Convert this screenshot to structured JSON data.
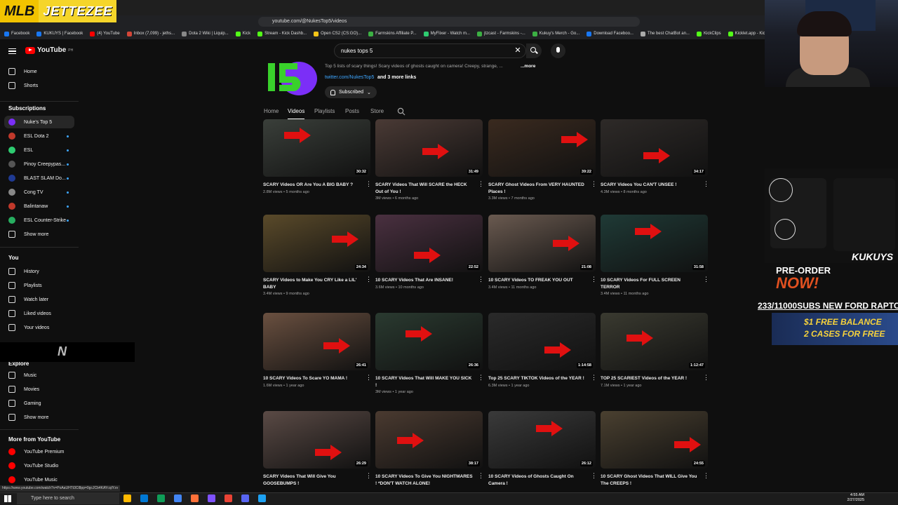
{
  "stream_overlay": {
    "logo_left": "MLB",
    "logo_right": "JETTEZEE",
    "bar_mark": "N",
    "subs_ticker": "233/11000SUBS NEW FORD RAPTOR",
    "preorder": "PRE-ORDER",
    "now": "NOW!",
    "brand": "KUKUYS",
    "promo_line1": "$1 FREE BALANCE",
    "promo_line2": "2 CASES FOR FREE"
  },
  "browser": {
    "url": "youtube.com/@NukesTop5/videos",
    "status_url": "https://www.youtube.com/watch?v=PoAaUHTt3Cl8pp=0gcJCb4KAYcqIYzv",
    "bookmarks": [
      "Facebook",
      "KUKUYS | Facebook",
      "(4) YouTube",
      "Inbox (7,099) - jeths...",
      "Dota 2 Wiki | Liquip...",
      "Kick",
      "Stream - Kick Dashb...",
      "Open CS2 (CS:GO)...",
      "Farmskins Affiliate P...",
      "MyFlixer - Watch m...",
      "jtzcast - Farmskins -...",
      "Kukuy's Merch - Go...",
      "Download Faceboo...",
      "The best ChatBot an...",
      "KickClips",
      "Kicklet.app - Kick..."
    ]
  },
  "header": {
    "logo": "YouTube",
    "region": "PH",
    "search_value": "nukes tops 5",
    "clear_icon": "✕"
  },
  "sidebar": {
    "home": "Home",
    "shorts": "Shorts",
    "subscriptions_heading": "Subscriptions",
    "subscriptions": [
      {
        "label": "Nuke's Top 5",
        "color": "#7b2ff7"
      },
      {
        "label": "ESL Dota 2",
        "color": "#c0392b"
      },
      {
        "label": "ESL",
        "color": "#2ecc71"
      },
      {
        "label": "Pinoy Creepypas...",
        "color": "#555555"
      },
      {
        "label": "BLAST SLAM Do...",
        "color": "#1f3a93"
      },
      {
        "label": "Cong TV",
        "color": "#888888"
      },
      {
        "label": "Balintanaw",
        "color": "#c0392b"
      },
      {
        "label": "ESL Counter-Strike",
        "color": "#27ae60"
      }
    ],
    "show_more": "Show more",
    "you_heading": "You",
    "you_items": [
      "History",
      "Playlists",
      "Watch later",
      "Liked videos",
      "Your videos"
    ],
    "explore_heading": "Explore",
    "explore_items": [
      "Music",
      "Movies",
      "Gaming"
    ],
    "show_more_2": "Show more",
    "more_heading": "More from YouTube",
    "more_items": [
      "YouTube Premium",
      "YouTube Studio",
      "YouTube Music"
    ]
  },
  "channel": {
    "description": "Top 5 lists of scary things! Scary videos of ghosts caught on camera! Creepy, strange, ...",
    "more": "...more",
    "link": "twitter.com/NukesTop5",
    "link_extra": "and 3 more links",
    "subscribed": "Subscribed",
    "tabs": [
      "Home",
      "Videos",
      "Playlists",
      "Posts",
      "Store"
    ]
  },
  "videos": [
    {
      "title": "SCARY Videos OR Are You A BIG BABY ?",
      "meta": "2.8M views • 5 months ago",
      "duration": "30:32",
      "bg": "#3a3f3a"
    },
    {
      "title": "SCARY Videos That Will SCARE the HECK Out of You !",
      "meta": "3M views • 6 months ago",
      "duration": "31:49",
      "bg": "#4a3a35"
    },
    {
      "title": "SCARY Ghost Videos From VERY HAUNTED Places !",
      "meta": "3.3M views • 7 months ago",
      "duration": "39:22",
      "bg": "#3a2a1f"
    },
    {
      "title": "SCARY Videos You CAN'T UNSEE !",
      "meta": "4.3M views • 8 months ago",
      "duration": "34:17",
      "bg": "#2e2a28"
    },
    {
      "title": "SCARY Videos to Make You CRY Like a LIL' BABY",
      "meta": "3.4M views • 9 months ago",
      "duration": "24:34",
      "bg": "#5a4a2a"
    },
    {
      "title": "10 SCARY Videos That Are INSANE!",
      "meta": "3.6M views • 10 months ago",
      "duration": "22:52",
      "bg": "#4a3040"
    },
    {
      "title": "10 SCARY Videos TO FREAK YOU OUT",
      "meta": "3.4M views • 11 months ago",
      "duration": "21:08",
      "bg": "#6a5a50"
    },
    {
      "title": "10 SCARY Videos For FULL SCREEN TERROR",
      "meta": "3.4M views • 11 months ago",
      "duration": "31:58",
      "bg": "#1f3a36"
    },
    {
      "title": "10 SCARY Videos To Scare YO MAMA !",
      "meta": "1.6M views • 1 year ago",
      "duration": "26:41",
      "bg": "#6a5040"
    },
    {
      "title": "10 SCARY Videos That Will MAKE YOU SICK !",
      "meta": "3M views • 1 year ago",
      "duration": "26:36",
      "bg": "#2a3a30"
    },
    {
      "title": "Top 25 SCARY TIKTOK Videos of the YEAR !",
      "meta": "6.3M views • 1 year ago",
      "duration": "1:14:58",
      "bg": "#2a2a2a"
    },
    {
      "title": "TOP 25 SCARIEST Videos of the YEAR !",
      "meta": "7.1M views • 1 year ago",
      "duration": "1:12:47",
      "bg": "#3a3a30"
    },
    {
      "title": "SCARY Videos That Will Give You GOOSEBUMPS !",
      "meta": "",
      "duration": "26:29",
      "bg": "#5a4a45"
    },
    {
      "title": "10 SCARY Videos To Give You NIGHTMARES ! *DON'T WATCH ALONE!",
      "meta": "",
      "duration": "38:17",
      "bg": "#4a3a30"
    },
    {
      "title": "10 SCARY Videos of Ghosts Caught On Camera !",
      "meta": "",
      "duration": "26:12",
      "bg": "#3a3a3a"
    },
    {
      "title": "10 SCARY Ghost Videos That WILL Give You The CREEPS !",
      "meta": "",
      "duration": "24:55",
      "bg": "#4a4030"
    }
  ],
  "taskbar": {
    "search_placeholder": "Type here to search",
    "time": "4:55 AM",
    "date": "2/27/2025"
  }
}
